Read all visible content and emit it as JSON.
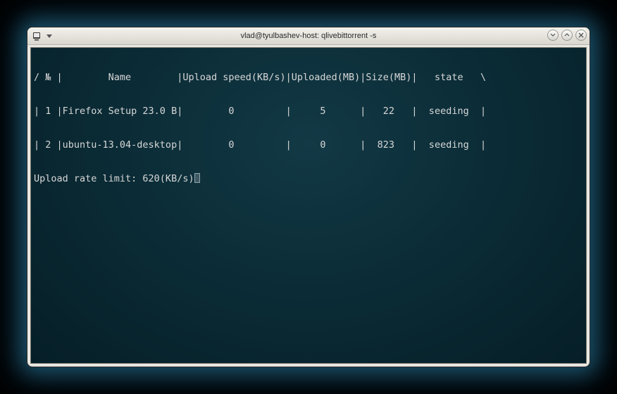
{
  "window": {
    "title": "vlad@tyulbashev-host: qlivebittorrent -s"
  },
  "terminal": {
    "header": {
      "left_border": "/",
      "right_border": "\\",
      "columns": {
        "num": "№",
        "name": "Name",
        "upload_speed": "Upload speed(KB/s)",
        "uploaded": "Uploaded(MB)",
        "size": "Size(MB)",
        "state": "state"
      }
    },
    "rows": [
      {
        "num": "1",
        "name": "Firefox Setup 23.0 B",
        "upload_speed": "0",
        "uploaded": "5",
        "size": "22",
        "state": "seeding"
      },
      {
        "num": "2",
        "name": "ubuntu-13.04-desktop",
        "upload_speed": "0",
        "uploaded": "0",
        "size": "823",
        "state": "seeding"
      }
    ],
    "footer": {
      "label": "Upload rate limit:",
      "value": "620(KB/s)"
    }
  }
}
